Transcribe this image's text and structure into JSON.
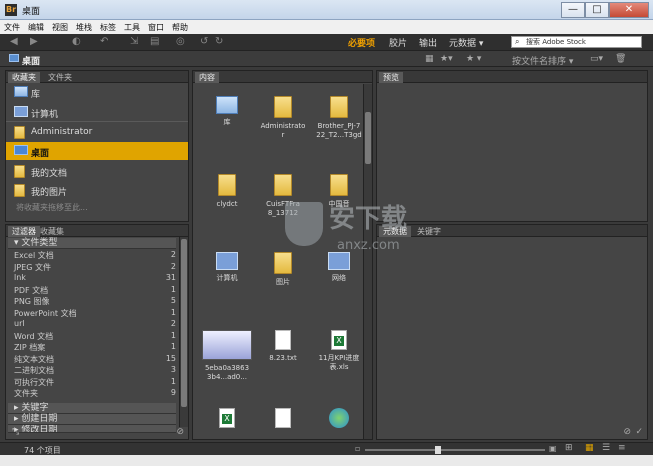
{
  "window": {
    "title": "桌面",
    "app_icon_letter": "Br",
    "buttons": {
      "minimize": "—",
      "maximize": "□",
      "close": "✕"
    }
  },
  "menu": [
    "文件",
    "编辑",
    "视图",
    "堆栈",
    "标签",
    "工具",
    "窗口",
    "帮助"
  ],
  "toolbar": {
    "workspaces": [
      {
        "label": "必要项",
        "active": true
      },
      {
        "label": "胶片",
        "active": false
      },
      {
        "label": "输出",
        "active": false
      },
      {
        "label": "元数据 ▾",
        "active": false
      }
    ],
    "search_placeholder": "搜索 Adobe Stock"
  },
  "pathbar": {
    "crumb": "桌面",
    "sort_label": "按文件名排序 ▾"
  },
  "favorites_panel": {
    "tabs": [
      "收藏夹",
      "文件夹"
    ],
    "items": [
      {
        "label": "库",
        "icon": "library-icon"
      },
      {
        "label": "计算机",
        "icon": "computer-icon"
      },
      {
        "label": "Administrator",
        "icon": "user-folder-icon"
      },
      {
        "label": "桌面",
        "icon": "desktop-icon",
        "selected": true
      },
      {
        "label": "我的文档",
        "icon": "documents-icon"
      },
      {
        "label": "我的图片",
        "icon": "pictures-icon"
      }
    ],
    "hint": "将收藏夹拖移至此..."
  },
  "filter_panel": {
    "tabs": [
      "过滤器",
      "收藏集"
    ],
    "category": "文件类型",
    "rows": [
      {
        "label": "Excel 文档",
        "count": "2"
      },
      {
        "label": "JPEG 文件",
        "count": "2"
      },
      {
        "label": "lnk",
        "count": "31"
      },
      {
        "label": "PDF 文档",
        "count": "1"
      },
      {
        "label": "PNG 图像",
        "count": "5"
      },
      {
        "label": "PowerPoint 文档",
        "count": "1"
      },
      {
        "label": "url",
        "count": "2"
      },
      {
        "label": "Word 文档",
        "count": "1"
      },
      {
        "label": "ZIP 档案",
        "count": "1"
      },
      {
        "label": "纯文本文档",
        "count": "15"
      },
      {
        "label": "二进制文档",
        "count": "3"
      },
      {
        "label": "可执行文件",
        "count": "1"
      },
      {
        "label": "文件夹",
        "count": "9"
      }
    ],
    "more_categories": [
      "关键字",
      "创建日期",
      "修改日期"
    ]
  },
  "content_panel": {
    "tab": "内容",
    "items": [
      {
        "label": "库",
        "type": "library"
      },
      {
        "label": "Administrato\nr",
        "type": "folder"
      },
      {
        "label": "Brother_PJ-7\n22_T2...T3gd",
        "type": "folder"
      },
      {
        "label": "clydct",
        "type": "folder"
      },
      {
        "label": "CuisFTFra\n8_13712",
        "type": "folder"
      },
      {
        "label": "中国音",
        "type": "folder"
      },
      {
        "label": "计算机",
        "type": "computer"
      },
      {
        "label": "图片",
        "type": "folder"
      },
      {
        "label": "网络",
        "type": "computer"
      },
      {
        "label": "5eba0a3863\n3b4...ad0...",
        "type": "screenshot"
      },
      {
        "label": "8.23.txt",
        "type": "doc"
      },
      {
        "label": "11月KPI进度\n表.xls",
        "type": "xls"
      },
      {
        "label": "",
        "type": "xls"
      },
      {
        "label": "",
        "type": "doc"
      },
      {
        "label": "",
        "type": "edge"
      }
    ]
  },
  "preview_panel": {
    "tab": "预览"
  },
  "metadata_panel": {
    "tabs": [
      "元数据",
      "关键字"
    ]
  },
  "status": {
    "count": "74 个项目"
  },
  "watermark": {
    "main": "安下载",
    "sub": "anxz.com"
  }
}
